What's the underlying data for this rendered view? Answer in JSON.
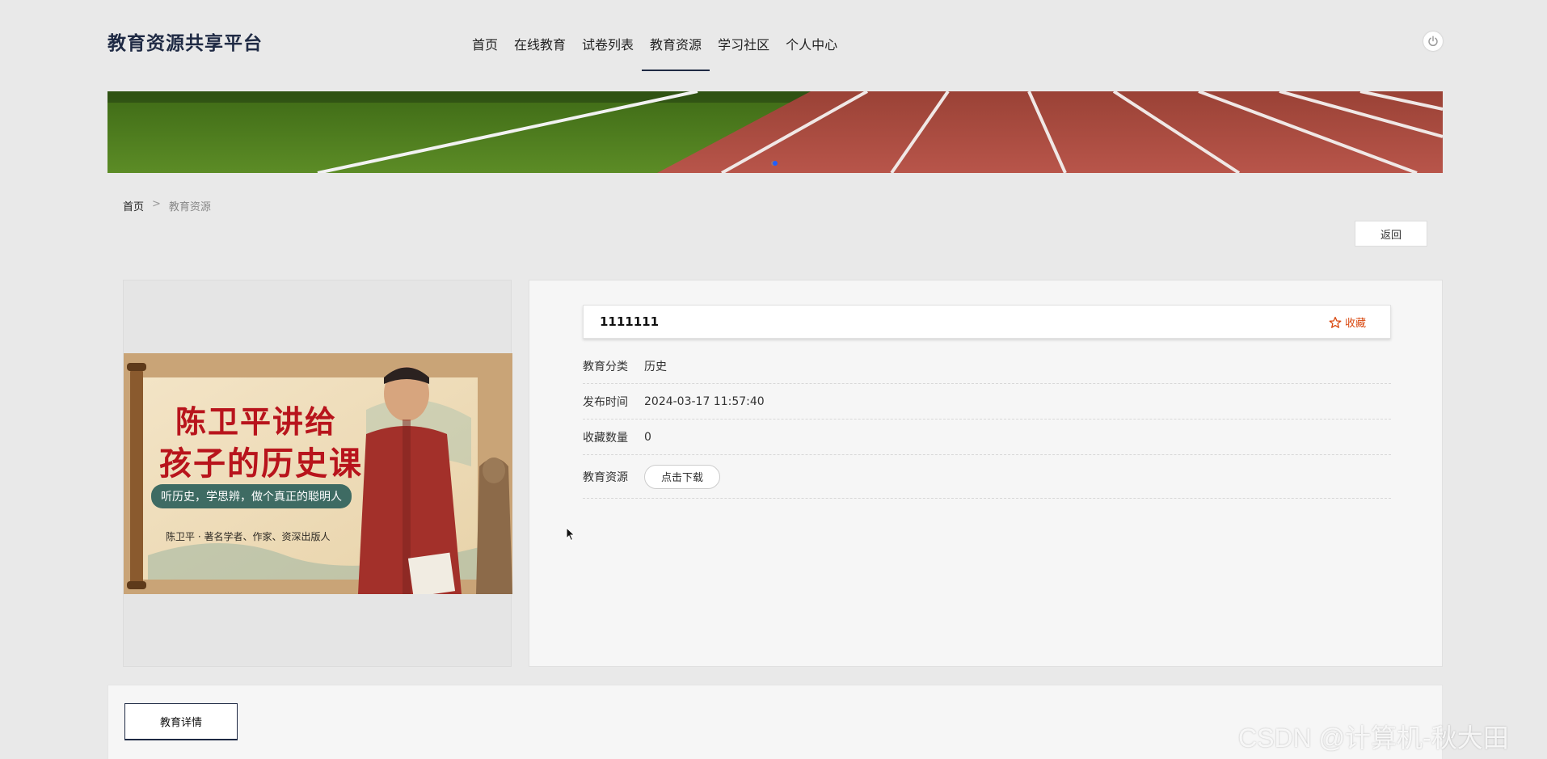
{
  "header": {
    "logo": "教育资源共享平台",
    "nav": [
      "首页",
      "在线教育",
      "试卷列表",
      "教育资源",
      "学习社区",
      "个人中心"
    ],
    "active_index": 3
  },
  "breadcrumb": {
    "home": "首页",
    "separator": ">",
    "current": "教育资源"
  },
  "back_label": "返回",
  "cover": {
    "title_line1": "陈卫平讲给",
    "title_line2": "孩子的历史课",
    "tagline": "听历史，学思辨，做个真正的聪明人",
    "author_line": "陈卫平 · 著名学者、作家、资深出版人"
  },
  "resource": {
    "title": "1111111",
    "favorite_label": "收藏",
    "rows": [
      {
        "label": "教育分类",
        "value": "历史"
      },
      {
        "label": "发布时间",
        "value": "2024-03-17 11:57:40"
      },
      {
        "label": "收藏数量",
        "value": "0"
      },
      {
        "label": "教育资源",
        "button": "点击下载"
      }
    ]
  },
  "detail_tab": "教育详情",
  "watermark": "CSDN @计算机-秋大田",
  "colors": {
    "accent": "#1f2a44",
    "favorite": "#d9480f",
    "track": "#b04a3d",
    "turf": "#4d7a1e"
  },
  "icons": {
    "power": "power-icon",
    "favorite": "star-outline-icon"
  }
}
